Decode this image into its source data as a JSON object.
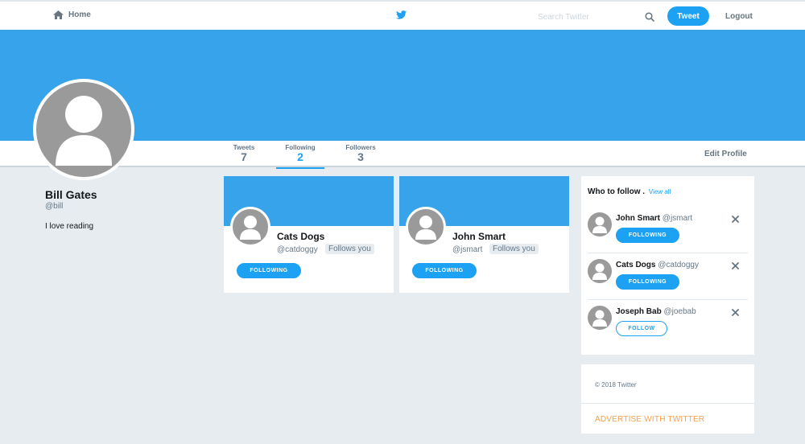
{
  "nav": {
    "home_label": "Home",
    "search_placeholder": "Search Twitter",
    "tweet_label": "Tweet",
    "logout_label": "Logout"
  },
  "stats": [
    {
      "label": "Tweets",
      "value": "7"
    },
    {
      "label": "Following",
      "value": "2"
    },
    {
      "label": "Followers",
      "value": "3"
    }
  ],
  "edit_profile_label": "Edit Profile",
  "profile": {
    "name": "Bill Gates",
    "handle": "@bill",
    "bio": "I love reading"
  },
  "following_cards": [
    {
      "name": "Cats Dogs",
      "handle": "@catdoggy",
      "follows_label": "Follows you",
      "button_label": "FOLLOWING"
    },
    {
      "name": "John Smart",
      "handle": "@jsmart",
      "follows_label": "Follows you",
      "button_label": "FOLLOWING"
    }
  ],
  "who_to_follow": {
    "title": "Who to follow .",
    "view_all": "View all",
    "items": [
      {
        "name": "John Smart",
        "handle": "@jsmart",
        "button_label": "FOLLOWING",
        "following": true
      },
      {
        "name": "Cats Dogs",
        "handle": "@catdoggy",
        "button_label": "FOLLOWING",
        "following": true
      },
      {
        "name": "Joseph Bab",
        "handle": "@joebab",
        "button_label": "FOLLOW",
        "following": false
      }
    ]
  },
  "footer": {
    "copyright": "© 2018 Twitter",
    "advertise": "ADVERTISE WITH TWITTER"
  },
  "colors": {
    "accent": "#1da1f2",
    "banner": "#36a3eb",
    "background": "#e6ecf0",
    "advertise": "#f5a04a"
  },
  "icons": {
    "home": "home-icon",
    "logo": "twitter-bird-icon",
    "search": "search-icon",
    "dismiss": "close-icon",
    "avatar": "default-avatar-icon"
  }
}
